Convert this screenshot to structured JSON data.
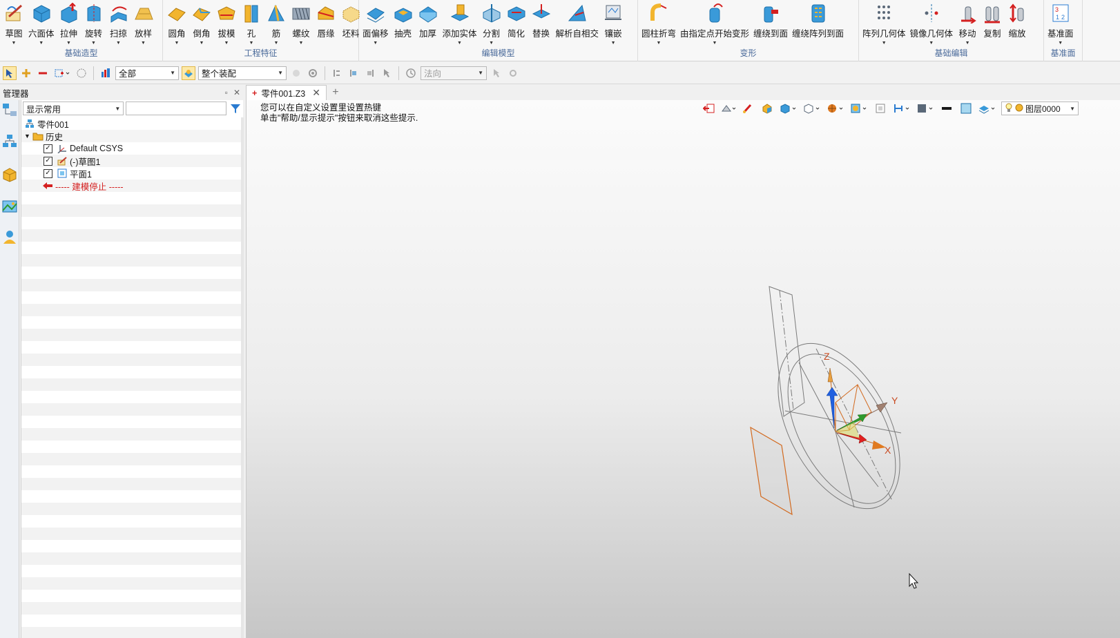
{
  "ribbon": {
    "groups": [
      {
        "label": "基础造型",
        "buttons": [
          "草图",
          "六面体",
          "拉伸",
          "旋转",
          "扫掠",
          "放样"
        ]
      },
      {
        "label": "工程特征",
        "buttons": [
          "圆角",
          "倒角",
          "拔模",
          "孔",
          "筋",
          "螺纹",
          "唇缘",
          "坯料"
        ]
      },
      {
        "label": "编辑模型",
        "buttons": [
          "面偏移",
          "抽壳",
          "加厚",
          "添加实体",
          "分割",
          "简化",
          "替换",
          "解析自相交",
          "镶嵌"
        ]
      },
      {
        "label": "变形",
        "buttons": [
          "圆柱折弯",
          "由指定点开始变形",
          "缠绕到面",
          "缠绕阵列到面"
        ]
      },
      {
        "label": "基础编辑",
        "buttons": [
          "阵列几何体",
          "镜像几何体",
          "移动",
          "复制",
          "缩放"
        ]
      },
      {
        "label": "基准面",
        "buttons": [
          "基准面"
        ]
      }
    ]
  },
  "toolbar": {
    "filter_value": "全部",
    "assembly_value": "整个装配",
    "direction_value": "法向"
  },
  "manager": {
    "title": "管理器",
    "display_mode": "显示常用",
    "search_value": "",
    "tree": {
      "root": "零件001",
      "history": "历史",
      "items": [
        "Default CSYS",
        "(-)草图1",
        "平面1"
      ],
      "stop_label": "----- 建模停止 -----"
    }
  },
  "tabs": {
    "active": "零件001.Z3"
  },
  "viewport": {
    "hint_line1": "您可以在自定义设置里设置热键",
    "hint_line2": "单击\"帮助/显示提示\"按钮来取消这些提示.",
    "layer": "图层0000",
    "axis_x": "X",
    "axis_y": "Y",
    "axis_z": "Z"
  },
  "colors": {
    "accent": "#4a6a9a",
    "stop_red": "#d42020",
    "sketch_orange": "#d2691e",
    "axis_red": "#e02020",
    "axis_green": "#2e9a2e",
    "axis_blue": "#2060e0"
  }
}
